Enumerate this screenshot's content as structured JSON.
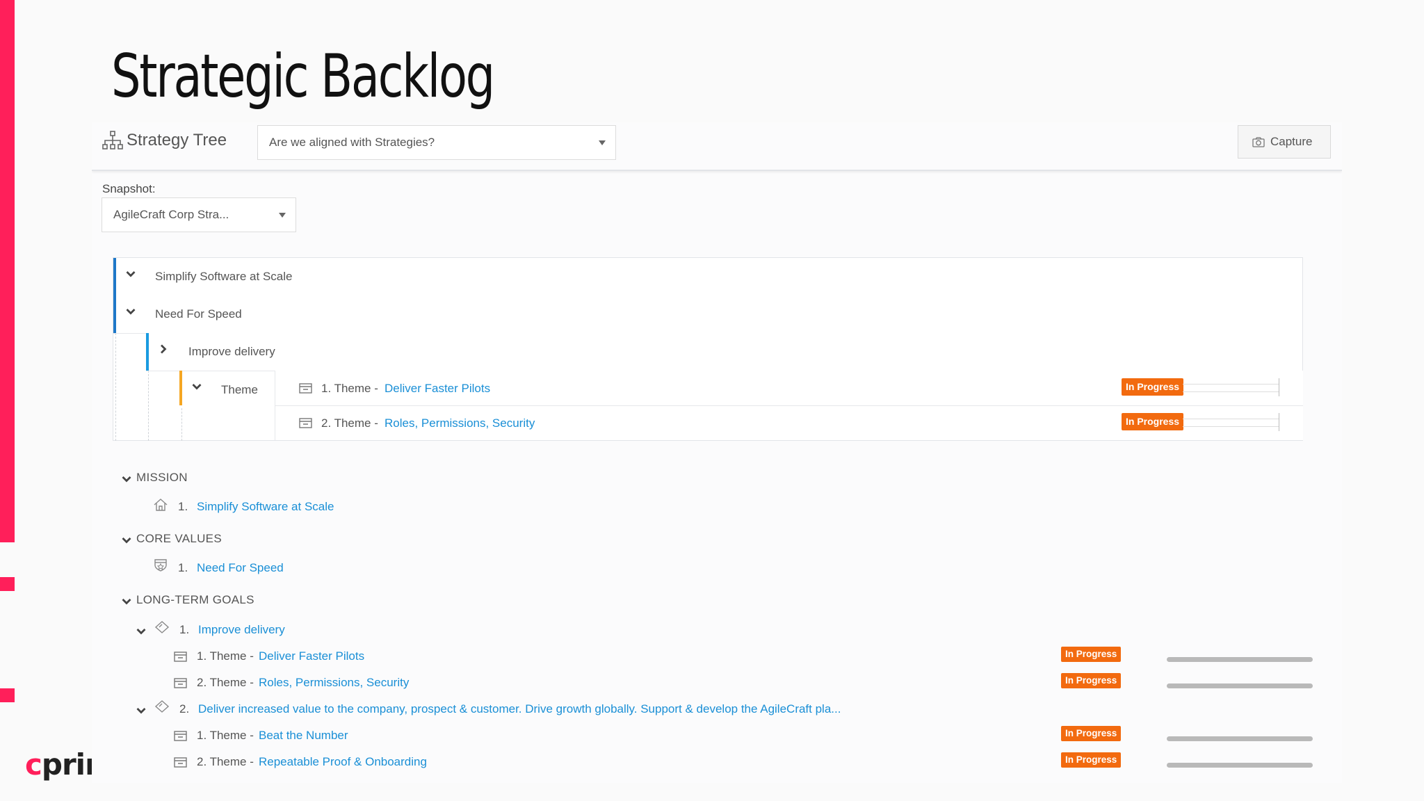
{
  "slide": {
    "title": "Strategic Backlog",
    "brand_text": "prin",
    "brand_initial": "c",
    "accent_color": "#ff1f5a"
  },
  "toolbar": {
    "strategy_tree_label": "Strategy Tree",
    "view_select_value": "Are we aligned with Strategies?",
    "capture_label": "Capture"
  },
  "snapshot": {
    "label": "Snapshot:",
    "value": "AgileCraft Corp Stra..."
  },
  "tree": {
    "mission": "Simplify Software at Scale",
    "core_value": "Need For Speed",
    "goal": "Improve delivery",
    "theme_header": "Theme",
    "themes": [
      {
        "prefix": "1. Theme -",
        "link": "Deliver Faster Pilots",
        "status": "In Progress"
      },
      {
        "prefix": "2. Theme -",
        "link": "Roles, Permissions, Security",
        "status": "In Progress"
      }
    ]
  },
  "sections": {
    "mission": {
      "header": "MISSION",
      "items": [
        {
          "num": "1.",
          "label": "Simplify Software at Scale"
        }
      ]
    },
    "core_values": {
      "header": "CORE VALUES",
      "items": [
        {
          "num": "1.",
          "label": "Need For Speed"
        }
      ]
    },
    "long_term_goals": {
      "header": "LONG-TERM GOALS",
      "goals": [
        {
          "num": "1.",
          "label": "Improve delivery",
          "themes": [
            {
              "prefix": "1. Theme -",
              "link": "Deliver Faster Pilots",
              "status": "In Progress"
            },
            {
              "prefix": "2. Theme -",
              "link": "Roles, Permissions, Security",
              "status": "In Progress"
            }
          ]
        },
        {
          "num": "2.",
          "label": "Deliver increased value to the company, prospect & customer. Drive growth globally. Support & develop the AgileCraft pla...",
          "themes": [
            {
              "prefix": "1. Theme -",
              "link": "Beat the Number",
              "status": "In Progress"
            },
            {
              "prefix": "2. Theme -",
              "link": "Repeatable Proof & Onboarding",
              "status": "In Progress"
            }
          ]
        }
      ]
    }
  },
  "colors": {
    "link": "#1a8fd6",
    "status_in_progress": "#f26a0f",
    "mission_bar": "#1e78c8",
    "goal_bar": "#1a9be0",
    "theme_bar": "#f5a623"
  },
  "icons": [
    "strategy-tree-icon",
    "camera-icon",
    "chevron-down-icon",
    "chevron-right-icon",
    "theme-box-icon",
    "home-icon",
    "shield-icon",
    "diamond-icon"
  ]
}
